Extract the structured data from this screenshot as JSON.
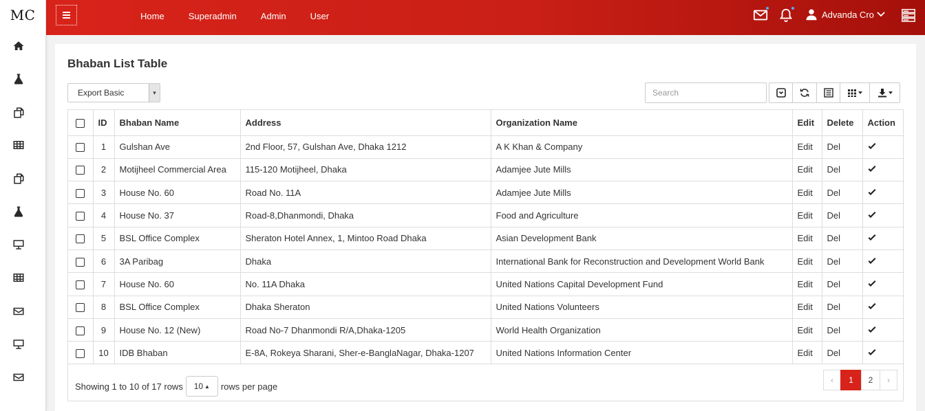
{
  "app": {
    "logo": "MC"
  },
  "sidebar": {
    "icons": [
      "home-icon",
      "flask-icon",
      "copy-icon",
      "table-icon",
      "copy-icon",
      "flask-icon",
      "desktop-icon",
      "table-icon",
      "envelope-icon",
      "desktop-icon",
      "envelope-icon"
    ]
  },
  "topbar": {
    "nav": [
      "Home",
      "Superadmin",
      "Admin",
      "User"
    ],
    "user_name": "Advanda Cro",
    "colors": {
      "primary": "#d8231a",
      "dark": "#a5100a",
      "badge": "#5aa9ff"
    }
  },
  "page": {
    "title": "Bhaban List Table",
    "export_label": "Export Basic",
    "search_placeholder": "Search",
    "toolbar_icons": [
      "toggle-icon",
      "refresh-icon",
      "list-view-icon",
      "columns-icon",
      "export-icon"
    ]
  },
  "table": {
    "columns": [
      "ID",
      "Bhaban Name",
      "Address",
      "Organization Name",
      "Edit",
      "Delete",
      "Action"
    ],
    "rows": [
      {
        "id": "1",
        "name": "Gulshan Ave",
        "address": "2nd Floor, 57, Gulshan Ave, Dhaka 1212",
        "org": "A K Khan & Company",
        "edit": "Edit",
        "del": "Del"
      },
      {
        "id": "2",
        "name": "Motijheel Commercial Area",
        "address": "115-120 Motijheel, Dhaka",
        "org": "Adamjee Jute Mills",
        "edit": "Edit",
        "del": "Del"
      },
      {
        "id": "3",
        "name": "House No. 60",
        "address": "Road No. 11A",
        "org": "Adamjee Jute Mills",
        "edit": "Edit",
        "del": "Del"
      },
      {
        "id": "4",
        "name": "House No. 37",
        "address": "Road-8,Dhanmondi, Dhaka",
        "org": "Food and Agriculture",
        "edit": "Edit",
        "del": "Del"
      },
      {
        "id": "5",
        "name": "BSL Office Complex",
        "address": "Sheraton Hotel Annex, 1, Mintoo Road Dhaka",
        "org": "Asian Development Bank",
        "edit": "Edit",
        "del": "Del"
      },
      {
        "id": "6",
        "name": "3A Paribag",
        "address": "Dhaka",
        "org": "International Bank for Reconstruction and Development World Bank",
        "edit": "Edit",
        "del": "Del"
      },
      {
        "id": "7",
        "name": "House No. 60",
        "address": "No. 11A Dhaka",
        "org": "United Nations Capital Development Fund",
        "edit": "Edit",
        "del": "Del"
      },
      {
        "id": "8",
        "name": "BSL Office Complex",
        "address": "Dhaka Sheraton",
        "org": "United Nations Volunteers",
        "edit": "Edit",
        "del": "Del"
      },
      {
        "id": "9",
        "name": "House No. 12 (New)",
        "address": "Road No-7 Dhanmondi R/A,Dhaka-1205",
        "org": "World Health Organization",
        "edit": "Edit",
        "del": "Del"
      },
      {
        "id": "10",
        "name": "IDB Bhaban",
        "address": "E-8A, Rokeya Sharani, Sher-e-BanglaNagar, Dhaka-1207",
        "org": "United Nations Information Center",
        "edit": "Edit",
        "del": "Del"
      }
    ]
  },
  "footer": {
    "showing": "Showing 1 to 10 of 17 rows",
    "page_size": "10",
    "rows_per_page": "rows per page",
    "pages": [
      "1",
      "2"
    ],
    "prev": "‹",
    "next": "›",
    "current_page": "1"
  }
}
